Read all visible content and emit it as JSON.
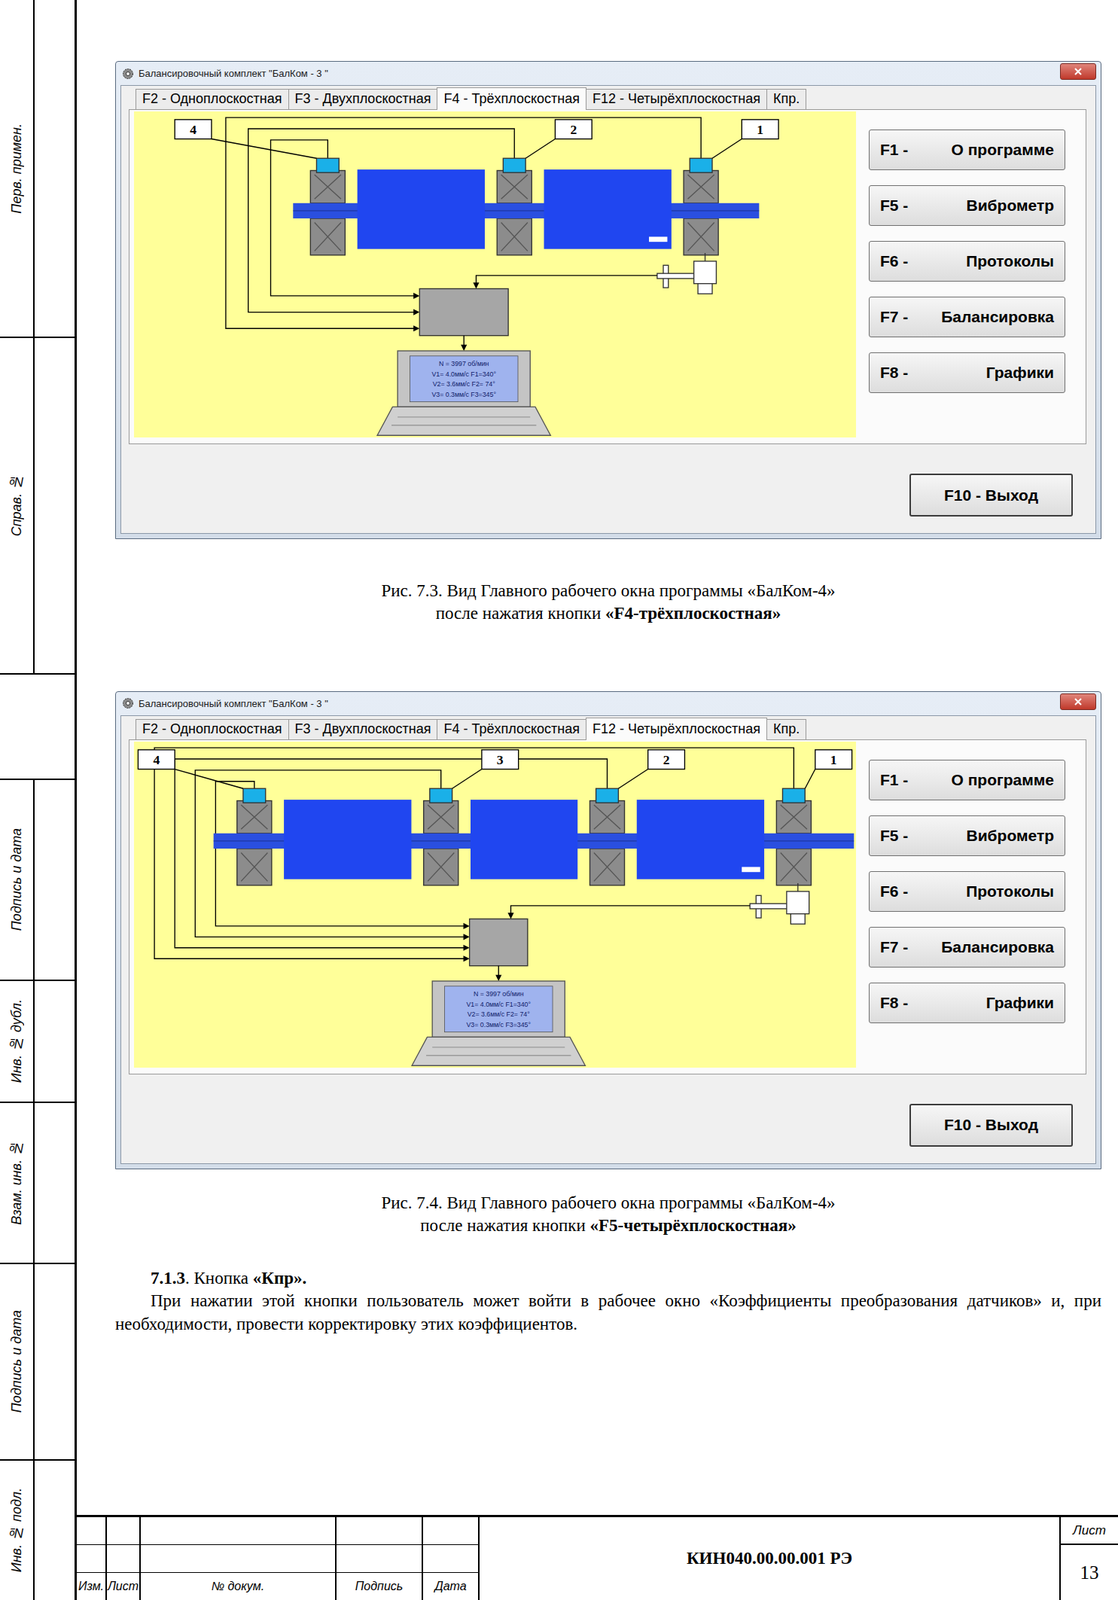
{
  "side_frame": {
    "cells": [
      "Перв. примен.",
      "Справ. №",
      "Подпись и дата",
      "Инв. № дубл.",
      "Взам. инв. №",
      "Подпись и дата",
      "Инв. № подл."
    ]
  },
  "screens": [
    {
      "window_title": "Балансировочный комплект \"БалКом - 3 \"",
      "tabs": [
        {
          "label": "F2 - Одноплоскостная",
          "selected": false
        },
        {
          "label": "F3 - Двухплоскостная",
          "selected": false
        },
        {
          "label": "F4 - Трёхплоскостная",
          "selected": true
        },
        {
          "label": "F12 - Четырёхплоскостная",
          "selected": false
        },
        {
          "label": "Кпр.",
          "selected": false
        }
      ],
      "diagram": {
        "sensor_labels": [
          "4",
          "2",
          "1"
        ],
        "laptop_lines": [
          "N = 3997 об/мин",
          "V1= 4.0мм/с  F1=340°",
          "V2= 3.6мм/с  F2= 74°",
          "V3= 0.3мм/с  F3=345°"
        ]
      },
      "buttons": [
        {
          "key": "F1 -",
          "label": "О программе"
        },
        {
          "key": "F5 -",
          "label": "Виброметр"
        },
        {
          "key": "F6 -",
          "label": "Протоколы"
        },
        {
          "key": "F7 -",
          "label": "Балансировка"
        },
        {
          "key": "F8 -",
          "label": "Графики"
        }
      ],
      "exit_button": "F10 - Выход",
      "caption": {
        "line1": "Рис. 7.3. Вид Главного рабочего окна программы «БалКом-4»",
        "line2_prefix": "после нажатия кнопки ",
        "line2_bold": "«F4-трёхплоскостная»"
      }
    },
    {
      "window_title": "Балансировочный комплект \"БалКом - 3 \"",
      "tabs": [
        {
          "label": "F2 - Одноплоскостная",
          "selected": false
        },
        {
          "label": "F3 - Двухплоскостная",
          "selected": false
        },
        {
          "label": "F4 - Трёхплоскостная",
          "selected": false
        },
        {
          "label": "F12 - Четырёхплоскостная",
          "selected": true
        },
        {
          "label": "Кпр.",
          "selected": false
        }
      ],
      "diagram": {
        "sensor_labels": [
          "4",
          "3",
          "2",
          "1"
        ],
        "laptop_lines": [
          "N = 3997 об/мин",
          "V1= 4.0мм/с  F1=340°",
          "V2= 3.6мм/с  F2= 74°",
          "V3= 0.3мм/с  F3=345°"
        ]
      },
      "buttons": [
        {
          "key": "F1 -",
          "label": "О программе"
        },
        {
          "key": "F5 -",
          "label": "Виброметр"
        },
        {
          "key": "F6 -",
          "label": "Протоколы"
        },
        {
          "key": "F7 -",
          "label": "Балансировка"
        },
        {
          "key": "F8 -",
          "label": "Графики"
        }
      ],
      "exit_button": "F10 - Выход",
      "caption": {
        "line1": "Рис. 7.4. Вид Главного рабочего окна программы «БалКом-4»",
        "line2_prefix": "после нажатия кнопки ",
        "line2_bold": "«F5-четырёхплоскостная»"
      }
    }
  ],
  "section": {
    "number": "7.1.3",
    "title_prefix": ". Кнопка ",
    "title": "«Кпр».",
    "body": "При нажатии этой кнопки  пользователь может войти в рабочее окно «Коэффициенты преобразования датчиков» и, при необходимости, провести корректировку этих коэффициентов."
  },
  "title_block": {
    "headers": [
      "Изм.",
      "Лист",
      "№ докум.",
      "Подпись",
      "Дата"
    ],
    "code": "КИН040.00.00.001 РЭ",
    "sheet_label": "Лист",
    "sheet": "13"
  }
}
